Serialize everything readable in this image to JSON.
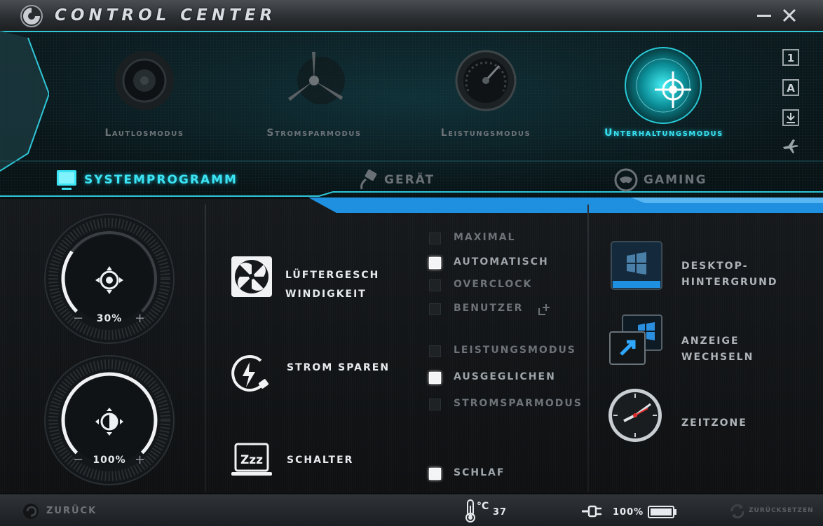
{
  "window": {
    "title": "CONTROL CENTER"
  },
  "modes": [
    {
      "label": "Lautlosmodus",
      "active": false
    },
    {
      "label": "Stromsparmodus",
      "active": false
    },
    {
      "label": "Leistungsmodus",
      "active": false
    },
    {
      "label": "Unterhaltungsmodus",
      "active": true
    }
  ],
  "tabs": [
    {
      "label": "SYSTEMPROGRAMM",
      "active": true
    },
    {
      "label": "GERÄT",
      "active": false
    },
    {
      "label": "GAMING",
      "active": false
    }
  ],
  "side_icons": {
    "profile_1": "1",
    "profile_a": "A"
  },
  "dials": {
    "fan": {
      "value": "30%",
      "level": 0.3,
      "minus": "−",
      "plus": "+"
    },
    "brightness": {
      "value": "100%",
      "level": 1.0,
      "minus": "−",
      "plus": "+"
    }
  },
  "features": {
    "fan": {
      "line1": "LÜFTERGESCH",
      "line2": "WINDIGKEIT"
    },
    "power": {
      "label": "STROM SPAREN"
    },
    "sleep": {
      "label": "SCHALTER"
    }
  },
  "fan_options": [
    {
      "label": "MAXIMAL",
      "checked": false
    },
    {
      "label": "AUTOMATISCH",
      "checked": true
    },
    {
      "label": "OVERCLOCK",
      "checked": false
    },
    {
      "label": "BENUTZER",
      "checked": false
    }
  ],
  "power_options": [
    {
      "label": "LEISTUNGSMODUS",
      "checked": false
    },
    {
      "label": "AUSGEGLICHEN",
      "checked": true
    },
    {
      "label": "STROMSPARMODUS",
      "checked": false
    }
  ],
  "sleep_options": [
    {
      "label": "SCHLAF",
      "checked": true
    }
  ],
  "shortcuts": {
    "wallpaper": {
      "line1": "DESKTOP-",
      "line2": "HINTERGRUND"
    },
    "display": {
      "line1": "ANZEIGE",
      "line2": "WECHSELN"
    },
    "timezone": {
      "line1": "ZEITZONE"
    }
  },
  "status": {
    "back_label": "ZURÜCK",
    "temp_unit": "°C",
    "temp_value": "37",
    "battery_value": "100%",
    "battery_level": 1.0,
    "reset_label": "ZURÜCKSETZEN"
  },
  "colors": {
    "accent": "#38e1f0",
    "accent_glow": "#18a9bb",
    "stripe_blue": "#1f8fe0",
    "inactive_text": "#6c7378"
  },
  "icons": {
    "app": "control-center-logo",
    "mode_silent": "speaker-icon",
    "mode_power_save": "propeller-icon",
    "mode_performance": "speedometer-icon",
    "mode_entertainment": "radar-target-icon",
    "tab_system": "monitor-icon",
    "tab_device": "usb-plug-icon",
    "tab_gaming": "gamepad-icon"
  }
}
